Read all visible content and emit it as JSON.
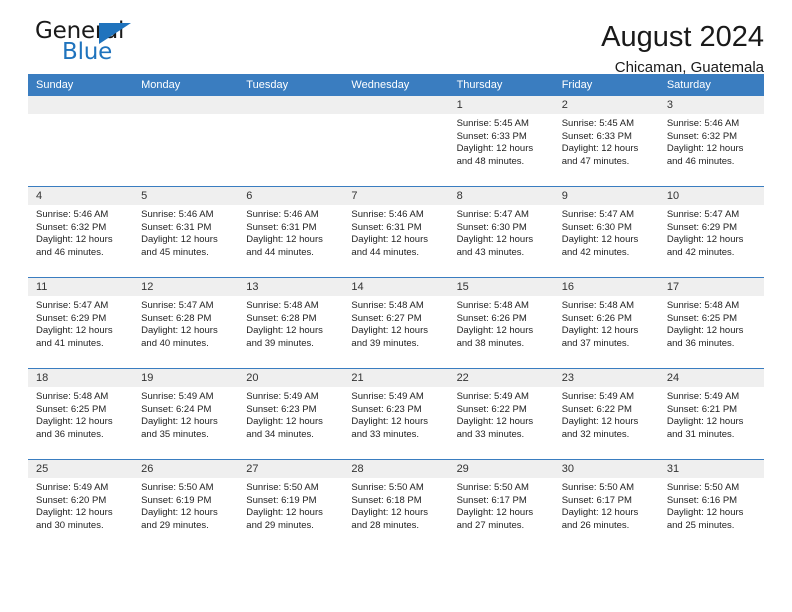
{
  "logo": {
    "word_top": "General",
    "word_bottom": "Blue",
    "triangle_icon": "blue-triangle-icon",
    "accent_color": "#1f73bd"
  },
  "header": {
    "title": "August 2024",
    "subtitle": "Chicaman, Guatemala"
  },
  "calendar": {
    "header_bg": "#3a7dc0",
    "daynum_bg": "#efefef",
    "weekday_headers": [
      "Sunday",
      "Monday",
      "Tuesday",
      "Wednesday",
      "Thursday",
      "Friday",
      "Saturday"
    ],
    "weeks": [
      [
        {
          "day": "",
          "empty": true
        },
        {
          "day": "",
          "empty": true
        },
        {
          "day": "",
          "empty": true
        },
        {
          "day": "",
          "empty": true
        },
        {
          "day": "1",
          "sunrise": "Sunrise: 5:45 AM",
          "sunset": "Sunset: 6:33 PM",
          "daylight_line1": "Daylight: 12 hours",
          "daylight_line2": "and 48 minutes."
        },
        {
          "day": "2",
          "sunrise": "Sunrise: 5:45 AM",
          "sunset": "Sunset: 6:33 PM",
          "daylight_line1": "Daylight: 12 hours",
          "daylight_line2": "and 47 minutes."
        },
        {
          "day": "3",
          "sunrise": "Sunrise: 5:46 AM",
          "sunset": "Sunset: 6:32 PM",
          "daylight_line1": "Daylight: 12 hours",
          "daylight_line2": "and 46 minutes."
        }
      ],
      [
        {
          "day": "4",
          "sunrise": "Sunrise: 5:46 AM",
          "sunset": "Sunset: 6:32 PM",
          "daylight_line1": "Daylight: 12 hours",
          "daylight_line2": "and 46 minutes."
        },
        {
          "day": "5",
          "sunrise": "Sunrise: 5:46 AM",
          "sunset": "Sunset: 6:31 PM",
          "daylight_line1": "Daylight: 12 hours",
          "daylight_line2": "and 45 minutes."
        },
        {
          "day": "6",
          "sunrise": "Sunrise: 5:46 AM",
          "sunset": "Sunset: 6:31 PM",
          "daylight_line1": "Daylight: 12 hours",
          "daylight_line2": "and 44 minutes."
        },
        {
          "day": "7",
          "sunrise": "Sunrise: 5:46 AM",
          "sunset": "Sunset: 6:31 PM",
          "daylight_line1": "Daylight: 12 hours",
          "daylight_line2": "and 44 minutes."
        },
        {
          "day": "8",
          "sunrise": "Sunrise: 5:47 AM",
          "sunset": "Sunset: 6:30 PM",
          "daylight_line1": "Daylight: 12 hours",
          "daylight_line2": "and 43 minutes."
        },
        {
          "day": "9",
          "sunrise": "Sunrise: 5:47 AM",
          "sunset": "Sunset: 6:30 PM",
          "daylight_line1": "Daylight: 12 hours",
          "daylight_line2": "and 42 minutes."
        },
        {
          "day": "10",
          "sunrise": "Sunrise: 5:47 AM",
          "sunset": "Sunset: 6:29 PM",
          "daylight_line1": "Daylight: 12 hours",
          "daylight_line2": "and 42 minutes."
        }
      ],
      [
        {
          "day": "11",
          "sunrise": "Sunrise: 5:47 AM",
          "sunset": "Sunset: 6:29 PM",
          "daylight_line1": "Daylight: 12 hours",
          "daylight_line2": "and 41 minutes."
        },
        {
          "day": "12",
          "sunrise": "Sunrise: 5:47 AM",
          "sunset": "Sunset: 6:28 PM",
          "daylight_line1": "Daylight: 12 hours",
          "daylight_line2": "and 40 minutes."
        },
        {
          "day": "13",
          "sunrise": "Sunrise: 5:48 AM",
          "sunset": "Sunset: 6:28 PM",
          "daylight_line1": "Daylight: 12 hours",
          "daylight_line2": "and 39 minutes."
        },
        {
          "day": "14",
          "sunrise": "Sunrise: 5:48 AM",
          "sunset": "Sunset: 6:27 PM",
          "daylight_line1": "Daylight: 12 hours",
          "daylight_line2": "and 39 minutes."
        },
        {
          "day": "15",
          "sunrise": "Sunrise: 5:48 AM",
          "sunset": "Sunset: 6:26 PM",
          "daylight_line1": "Daylight: 12 hours",
          "daylight_line2": "and 38 minutes."
        },
        {
          "day": "16",
          "sunrise": "Sunrise: 5:48 AM",
          "sunset": "Sunset: 6:26 PM",
          "daylight_line1": "Daylight: 12 hours",
          "daylight_line2": "and 37 minutes."
        },
        {
          "day": "17",
          "sunrise": "Sunrise: 5:48 AM",
          "sunset": "Sunset: 6:25 PM",
          "daylight_line1": "Daylight: 12 hours",
          "daylight_line2": "and 36 minutes."
        }
      ],
      [
        {
          "day": "18",
          "sunrise": "Sunrise: 5:48 AM",
          "sunset": "Sunset: 6:25 PM",
          "daylight_line1": "Daylight: 12 hours",
          "daylight_line2": "and 36 minutes."
        },
        {
          "day": "19",
          "sunrise": "Sunrise: 5:49 AM",
          "sunset": "Sunset: 6:24 PM",
          "daylight_line1": "Daylight: 12 hours",
          "daylight_line2": "and 35 minutes."
        },
        {
          "day": "20",
          "sunrise": "Sunrise: 5:49 AM",
          "sunset": "Sunset: 6:23 PM",
          "daylight_line1": "Daylight: 12 hours",
          "daylight_line2": "and 34 minutes."
        },
        {
          "day": "21",
          "sunrise": "Sunrise: 5:49 AM",
          "sunset": "Sunset: 6:23 PM",
          "daylight_line1": "Daylight: 12 hours",
          "daylight_line2": "and 33 minutes."
        },
        {
          "day": "22",
          "sunrise": "Sunrise: 5:49 AM",
          "sunset": "Sunset: 6:22 PM",
          "daylight_line1": "Daylight: 12 hours",
          "daylight_line2": "and 33 minutes."
        },
        {
          "day": "23",
          "sunrise": "Sunrise: 5:49 AM",
          "sunset": "Sunset: 6:22 PM",
          "daylight_line1": "Daylight: 12 hours",
          "daylight_line2": "and 32 minutes."
        },
        {
          "day": "24",
          "sunrise": "Sunrise: 5:49 AM",
          "sunset": "Sunset: 6:21 PM",
          "daylight_line1": "Daylight: 12 hours",
          "daylight_line2": "and 31 minutes."
        }
      ],
      [
        {
          "day": "25",
          "sunrise": "Sunrise: 5:49 AM",
          "sunset": "Sunset: 6:20 PM",
          "daylight_line1": "Daylight: 12 hours",
          "daylight_line2": "and 30 minutes."
        },
        {
          "day": "26",
          "sunrise": "Sunrise: 5:50 AM",
          "sunset": "Sunset: 6:19 PM",
          "daylight_line1": "Daylight: 12 hours",
          "daylight_line2": "and 29 minutes."
        },
        {
          "day": "27",
          "sunrise": "Sunrise: 5:50 AM",
          "sunset": "Sunset: 6:19 PM",
          "daylight_line1": "Daylight: 12 hours",
          "daylight_line2": "and 29 minutes."
        },
        {
          "day": "28",
          "sunrise": "Sunrise: 5:50 AM",
          "sunset": "Sunset: 6:18 PM",
          "daylight_line1": "Daylight: 12 hours",
          "daylight_line2": "and 28 minutes."
        },
        {
          "day": "29",
          "sunrise": "Sunrise: 5:50 AM",
          "sunset": "Sunset: 6:17 PM",
          "daylight_line1": "Daylight: 12 hours",
          "daylight_line2": "and 27 minutes."
        },
        {
          "day": "30",
          "sunrise": "Sunrise: 5:50 AM",
          "sunset": "Sunset: 6:17 PM",
          "daylight_line1": "Daylight: 12 hours",
          "daylight_line2": "and 26 minutes."
        },
        {
          "day": "31",
          "sunrise": "Sunrise: 5:50 AM",
          "sunset": "Sunset: 6:16 PM",
          "daylight_line1": "Daylight: 12 hours",
          "daylight_line2": "and 25 minutes."
        }
      ]
    ]
  }
}
